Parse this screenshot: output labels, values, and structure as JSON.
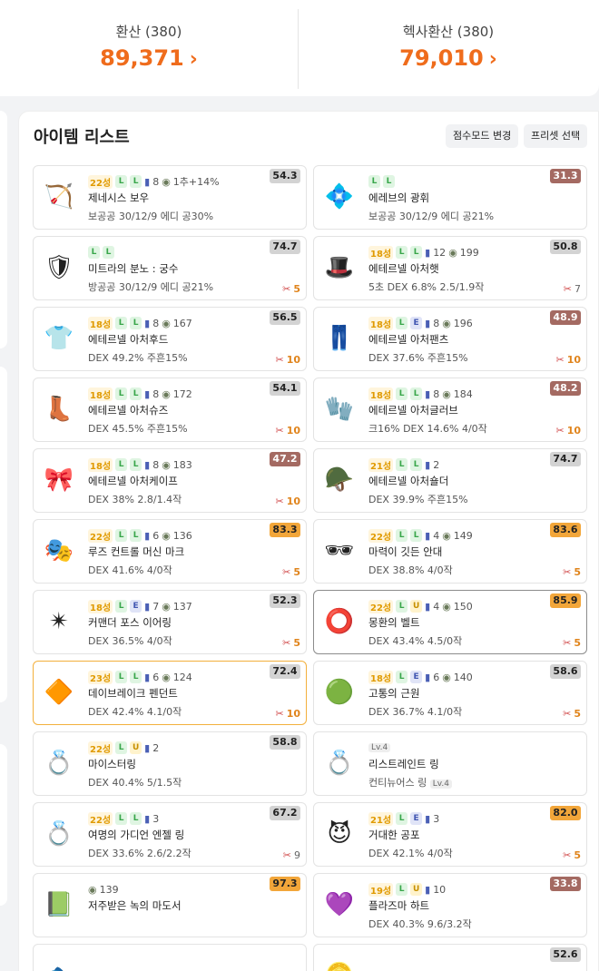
{
  "summary": {
    "left_label": "환산 (380)",
    "left_value": "89,371",
    "right_label": "헥사환산 (380)",
    "right_value": "79,010",
    "chevron": "›"
  },
  "panel": {
    "title": "아이템 리스트",
    "score_mode_button": "점수모드 변경",
    "preset_button": "프리셋 선택"
  },
  "colors": {
    "accent": "#ef6c1c",
    "score_gray": "#d3d3d3",
    "score_brown": "#a46a62",
    "score_orange": "#f2a63a"
  },
  "items": [
    {
      "icon": "bow-icon",
      "glyph": "🏹",
      "star": "22성",
      "badges": [
        "L",
        "L"
      ],
      "scroll": "8",
      "hammer": "1추+14%",
      "name": "제네시스 보우",
      "stats": "보공공 30/12/9 에디 공30%",
      "score": "54.3",
      "score_color": "gray",
      "scissors": ""
    },
    {
      "icon": "emblem-icon",
      "glyph": "💠",
      "star": "",
      "badges": [
        "L",
        "L"
      ],
      "scroll": "",
      "hammer": "",
      "name": "에레브의 광휘",
      "stats": "보공공 30/12/9 에디 공21%",
      "score": "31.3",
      "score_color": "brown",
      "scissors": ""
    },
    {
      "icon": "secondary-weapon-icon",
      "glyph": "🛡",
      "star": "",
      "badges": [
        "L",
        "L"
      ],
      "scroll": "",
      "hammer": "",
      "name": "미트라의 분노 : 궁수",
      "stats": "방공공 30/12/9 에디 공21%",
      "score": "74.7",
      "score_color": "gray",
      "scissors": "5"
    },
    {
      "icon": "hat-icon",
      "glyph": "🎩",
      "star": "18성",
      "badges": [
        "L",
        "L"
      ],
      "scroll": "12",
      "hammer": "199",
      "name": "에테르넬 아처햇",
      "stats": "5초 DEX 6.8%   2.5/1.9작",
      "score": "50.8",
      "score_color": "gray",
      "scissors": "7",
      "sdim": true
    },
    {
      "icon": "top-icon",
      "glyph": "👕",
      "star": "18성",
      "badges": [
        "L",
        "L"
      ],
      "scroll": "8",
      "hammer": "167",
      "name": "에테르넬 아처후드",
      "stats": "DEX 49.2%   주흔15%",
      "score": "56.5",
      "score_color": "gray",
      "scissors": "10"
    },
    {
      "icon": "pants-icon",
      "glyph": "👖",
      "star": "18성",
      "badges": [
        "L",
        "E"
      ],
      "scroll": "8",
      "hammer": "196",
      "name": "에테르넬 아처팬츠",
      "stats": "DEX 37.6%   주흔15%",
      "score": "48.9",
      "score_color": "brown",
      "scissors": "10"
    },
    {
      "icon": "shoes-icon",
      "glyph": "👢",
      "star": "18성",
      "badges": [
        "L",
        "L"
      ],
      "scroll": "8",
      "hammer": "172",
      "name": "에테르넬 아처슈즈",
      "stats": "DEX 45.5%   주흔15%",
      "score": "54.1",
      "score_color": "gray",
      "scissors": "10"
    },
    {
      "icon": "gloves-icon",
      "glyph": "🧤",
      "star": "18성",
      "badges": [
        "L",
        "L"
      ],
      "scroll": "8",
      "hammer": "184",
      "name": "에테르넬 아처글러브",
      "stats": "크16% DEX 14.6%   4/0작",
      "score": "48.2",
      "score_color": "brown",
      "scissors": "10"
    },
    {
      "icon": "cape-icon",
      "glyph": "🎀",
      "star": "18성",
      "badges": [
        "L",
        "L"
      ],
      "scroll": "8",
      "hammer": "183",
      "name": "에테르넬 아처케이프",
      "stats": "DEX 38%   2.8/1.4작",
      "score": "47.2",
      "score_color": "brown",
      "scissors": "10"
    },
    {
      "icon": "shoulder-icon",
      "glyph": "🪖",
      "star": "21성",
      "badges": [
        "L",
        "L"
      ],
      "scroll": "2",
      "hammer": "",
      "name": "에테르넬 아처숄더",
      "stats": "DEX 39.9%   주흔15%",
      "score": "74.7",
      "score_color": "gray",
      "scissors": ""
    },
    {
      "icon": "face-accessory-icon",
      "glyph": "🎭",
      "star": "22성",
      "badges": [
        "L",
        "L"
      ],
      "scroll": "6",
      "hammer": "136",
      "name": "루즈 컨트롤 머신 마크",
      "stats": "DEX 41.6%   4/0작",
      "score": "83.3",
      "score_color": "orange",
      "scissors": "5"
    },
    {
      "icon": "eye-accessory-icon",
      "glyph": "🕶",
      "star": "22성",
      "badges": [
        "L",
        "L"
      ],
      "scroll": "4",
      "hammer": "149",
      "name": "마력이 깃든 안대",
      "stats": "DEX 38.8%   4/0작",
      "score": "83.6",
      "score_color": "orange",
      "scissors": "5"
    },
    {
      "icon": "earring-icon",
      "glyph": "✴",
      "star": "18성",
      "badges": [
        "L",
        "E"
      ],
      "scroll": "7",
      "hammer": "137",
      "name": "커맨더 포스 이어링",
      "stats": "DEX 36.5%   4/0작",
      "score": "52.3",
      "score_color": "gray",
      "scissors": "5"
    },
    {
      "icon": "belt-icon",
      "glyph": "⭕",
      "star": "22성",
      "badges": [
        "L",
        "U"
      ],
      "scroll": "4",
      "hammer": "150",
      "name": "몽환의 벨트",
      "stats": "DEX 43.4%   4.5/0작",
      "score": "85.9",
      "score_color": "orange",
      "scissors": "5",
      "highlight": "gray"
    },
    {
      "icon": "pendant-icon",
      "glyph": "🔶",
      "star": "23성",
      "badges": [
        "L",
        "L"
      ],
      "scroll": "6",
      "hammer": "124",
      "name": "데이브레이크 펜던트",
      "stats": "DEX 42.4%   4.1/0작",
      "score": "72.4",
      "score_color": "gray",
      "scissors": "10",
      "highlight": "orange"
    },
    {
      "icon": "badge-icon",
      "glyph": "🟢",
      "star": "18성",
      "badges": [
        "L",
        "E"
      ],
      "scroll": "6",
      "hammer": "140",
      "name": "고통의 근원",
      "stats": "DEX 36.7%   4.1/0작",
      "score": "58.6",
      "score_color": "gray",
      "scissors": "5"
    },
    {
      "icon": "ring-icon",
      "glyph": "💍",
      "star": "22성",
      "badges": [
        "L",
        "U"
      ],
      "scroll": "2",
      "hammer": "",
      "name": "마이스터링",
      "stats": "DEX 40.4%   5/1.5작",
      "score": "58.8",
      "score_color": "gray",
      "scissors": ""
    },
    {
      "icon": "restraint-ring-icon",
      "glyph": "💍",
      "star": "",
      "lv": "Lv.4",
      "badges": [],
      "scroll": "",
      "hammer": "",
      "name": "리스트레인트 링",
      "stats": "컨티뉴어스 링",
      "stats_lv": "Lv.4",
      "score": "",
      "score_color": "",
      "scissors": ""
    },
    {
      "icon": "guardian-ring-icon",
      "glyph": "💍",
      "star": "22성",
      "badges": [
        "L",
        "L"
      ],
      "scroll": "3",
      "hammer": "",
      "name": "여명의 가디언 엔젤 링",
      "stats": "DEX 33.6%   2.6/2.2작",
      "score": "67.2",
      "score_color": "gray",
      "scissors": "9",
      "sdim": true
    },
    {
      "icon": "fear-ring-icon",
      "glyph": "😈",
      "star": "21성",
      "badges": [
        "L",
        "E"
      ],
      "scroll": "3",
      "hammer": "",
      "name": "거대한 공포",
      "stats": "DEX 42.1%   4/0작",
      "score": "82.0",
      "score_color": "orange",
      "scissors": "5"
    },
    {
      "icon": "book-icon",
      "glyph": "📗",
      "star": "",
      "badges": [],
      "scroll": "",
      "hammer": "139",
      "name": "저주받은 녹의 마도서",
      "stats": "",
      "score": "97.3",
      "score_color": "orange",
      "scissors": ""
    },
    {
      "icon": "heart-icon",
      "glyph": "💜",
      "star": "19성",
      "badges": [
        "L",
        "U"
      ],
      "scroll": "10",
      "hammer": "",
      "name": "플라즈마 하트",
      "stats": "DEX 40.3%   9.6/3.2작",
      "score": "33.8",
      "score_color": "brown",
      "scissors": ""
    },
    {
      "icon": "item-icon",
      "glyph": "🐟",
      "star": "",
      "badges": [],
      "scroll": "",
      "hammer": "",
      "name": "",
      "stats": "",
      "score": "",
      "score_color": "",
      "scissors": ""
    },
    {
      "icon": "item-icon",
      "glyph": "🪙",
      "star": "",
      "badges": [],
      "scroll": "",
      "hammer": "",
      "name": "",
      "stats": "",
      "score": "52.6",
      "score_color": "gray",
      "scissors": ""
    }
  ]
}
